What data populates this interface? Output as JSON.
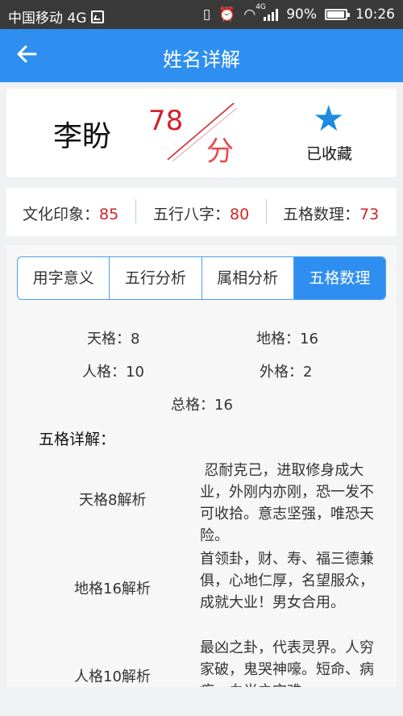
{
  "status_bar": {
    "carrier": "中国移动 4G",
    "network": "4G",
    "battery": "90%",
    "time": "10:26"
  },
  "header": {
    "title": "姓名详解"
  },
  "name_card": {
    "name": "李盼",
    "score": "78",
    "score_unit": "分",
    "favorite_label": "已收藏"
  },
  "summary": [
    {
      "label": "文化印象：",
      "value": "85"
    },
    {
      "label": "五行八字：",
      "value": "80"
    },
    {
      "label": "五格数理：",
      "value": "73"
    }
  ],
  "tabs": [
    {
      "label": "用字意义",
      "active": false
    },
    {
      "label": "五行分析",
      "active": false
    },
    {
      "label": "属相分析",
      "active": false
    },
    {
      "label": "五格数理",
      "active": true
    }
  ],
  "wuge": {
    "tian": "天格：8",
    "di": "地格：16",
    "ren": "人格：10",
    "wai": "外格：2",
    "zong": "总格：16"
  },
  "details_title": "五格详解：",
  "details": [
    {
      "label": "天格8解析",
      "text": "忍耐克己，进取修身成大业，外刚内亦刚，恐一发不可收拾。意志坚强，唯恐天险。"
    },
    {
      "label": "地格16解析",
      "text": "首领卦，财、寿、福三德兼俱，心地仁厚，名望服众，成就大业！男女合用。"
    },
    {
      "label": "人格10解析",
      "text": "最凶之卦，代表灵界。人穷家破，鬼哭神嚎。短命、病疾、血光之灾难"
    }
  ],
  "colors": {
    "primary": "#2f8ff0",
    "score_red": "#d0242a",
    "star_blue": "#1c8be0"
  }
}
